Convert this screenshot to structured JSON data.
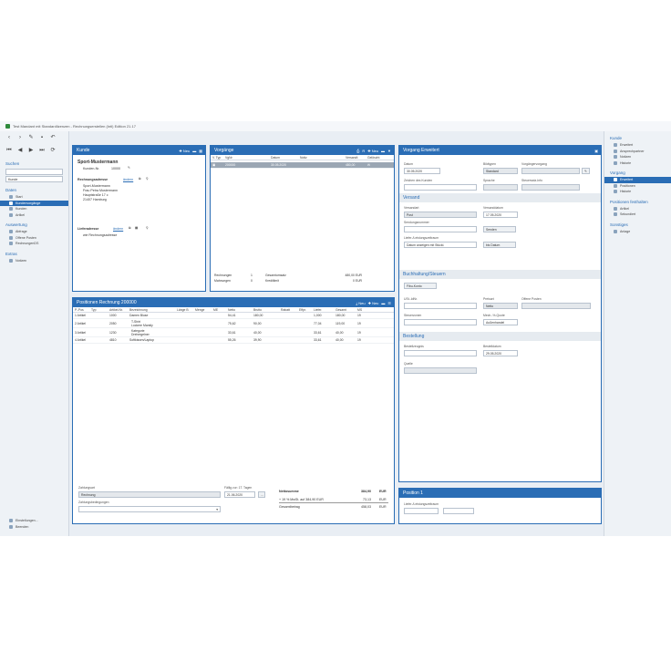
{
  "window": {
    "title": "Test Mandant mit Standardlizenzen - Rechnungserstellen (Intl) Edition 21.17"
  },
  "leftbar": {
    "search_head": "Suchen",
    "search_value": "",
    "search_scope": "Kunde",
    "daten_head": "Daten",
    "daten_items": [
      "Start",
      "Kundenvorgänge",
      "Kunden",
      "Artikel"
    ],
    "auswertung_head": "Auswertung",
    "auswertung_items": [
      "Abfrage",
      "Offene Posten",
      "RechnungenDS"
    ],
    "extras_head": "Extras",
    "extras_items": [
      "Notizen"
    ],
    "bottom_items": [
      "Einstellungen...",
      "Beenden"
    ]
  },
  "kunde": {
    "title": "Kunde",
    "new_label": "Neu",
    "name": "Sport-Mustermann",
    "kunden_nr_label": "Kunden-Nr.",
    "kunden_nr": "10000",
    "rechnungsadresse_label": "Rechnungsadresse",
    "andern": "ändern",
    "address": [
      "Sport-Mustermann",
      "Frau Petra Mustermann",
      "Hauptstraße 17 c",
      "21407 Hamburg"
    ],
    "lieferadresse_label": "Lieferadresse",
    "lieferadresse_value": "wie Rechnungsadresse"
  },
  "vorgaenge": {
    "title": "Vorgänge",
    "new_label": "Neu",
    "columns": [
      "V. Typ",
      "VgNr",
      "Datum",
      "Notiz",
      "Versandt",
      "Gelöscht"
    ],
    "row": {
      "nr": "200000",
      "datum": "30.05.2020",
      "betrag": "480,00"
    },
    "stats": [
      {
        "label": "Rechnungen",
        "count": "1",
        "key": "Gesamtumsatz",
        "value": "480,00 EUR"
      },
      {
        "label": "Mahnungen",
        "count": "0",
        "key": "Kreditlimit",
        "value": "0 EUR"
      }
    ]
  },
  "positionen": {
    "title": "Positionen Rechnung 200000",
    "new_label": "Neu",
    "columns": [
      "P.-Pos",
      "Typ",
      "Artikel-Nr.",
      "Bezeichnung",
      "Länge B",
      "Menge",
      "ME",
      "Netto",
      "Brutto",
      "Rabatt",
      "Effpr.",
      "Liefer.",
      "Gesamt",
      "MS"
    ],
    "rows": [
      {
        "pos": "1 Artikel",
        "nr": "1000",
        "bez": "Damen Bluse",
        "netto": "54,41",
        "brutto": "180,00",
        "liefer": "1,000",
        "gesamt": "180,00",
        "ms": "19"
      },
      {
        "pos": "2 Artikel",
        "nr": "2050",
        "bez": "T-Shirt",
        "bez2": "Lockere Mamily",
        "netto": "75,62",
        "brutto": "90,00",
        "liefer": "77,04",
        "gesamt": "119,00",
        "ms": "19"
      },
      {
        "pos": "3 Artikel",
        "nr": "1230",
        "bez": "Kategorie",
        "bez2": "Drehregelner",
        "netto": "33,61",
        "brutto": "40,00",
        "liefer": "33,61",
        "gesamt": "40,00",
        "ms": "19"
      },
      {
        "pos": "4 Artikel",
        "nr": "4810",
        "bez": "Softkissen/Laptop",
        "netto": "55,26",
        "brutto": "39,90",
        "liefer": "33,61",
        "gesamt": "40,00",
        "ms": "19"
      }
    ],
    "zahlungsart_label": "Zahlungsart",
    "zahlungsart_value": "Rechnung",
    "zahlungsbedingungen_label": "Zahlungsbedingungen",
    "faellig_label": "Fällig zur: 1T. Tagen",
    "faellig_value": "21.06.2020",
    "netto_label": "Nettosumme",
    "netto_value": "384,90",
    "mwst_label": "+ 19 % MwSt. auf 384,90 EUR",
    "mwst_value": "73,13",
    "gesamt_label": "Gesamtbetrag",
    "gesamt_value": "458,03",
    "currency": "EUR"
  },
  "vorgang": {
    "title": "Vorgang Erweitert",
    "datum_label": "Datum",
    "datum_value": "30.05.2020",
    "bildtypen_label": "Bildtypen",
    "bildtypen_value": "Standard",
    "vorgaengervorgang_label": "Vorgängervorgang",
    "zeichen_label": "Zeichen des Kunden",
    "sprache_label": "Sprache",
    "steuersatz_label": "Steuersatz-Info",
    "versand_head": "Versand",
    "versandart_label": "Versandart",
    "versandart_value": "Post",
    "versanddatum_label": "Versanddatum",
    "versanddatum_value": "17.05.2020",
    "sendungsnummer_label": "Sendungsnummer",
    "senden_label": "Senden",
    "liefer_label": "Liefer-/Leistungszeitraum",
    "liefer_value": "Datum anzeigen mit Stückl.",
    "bis_datum_label": "bis Datum",
    "buchhaltung_head": "Buchhaltung/Steuern",
    "fibu_label": "Fibu-Konto",
    "ust_label": "USt.-IdNr.",
    "preisart_label": "Preisart",
    "preisart_value": "Netto",
    "offene_label": "Offene Posten",
    "steuerzone_label": "Steuerzonen",
    "mech_label": "Mech.-%-Quote",
    "mech_value": "Außenhandel",
    "bestellung_head": "Bestellung",
    "bestellzeugnis_label": "Bestellzeugnis",
    "bestelldatum_label": "Bestelldatum",
    "bestelldatum_value": "29.05.2020",
    "quelle_label": "Quelle"
  },
  "position1": {
    "title": "Position 1",
    "label": "Liefer-/Leistungszeitraum"
  },
  "rightbar": {
    "kunde_head": "Kunde",
    "kunde_items": [
      "Erweitert",
      "Ansprechpartner",
      "Notizen",
      "Historie"
    ],
    "vorgang_head": "Vorgang",
    "vorgang_items": [
      "Erweitert",
      "Positionen",
      "Historie"
    ],
    "positionen_head": "Positionen festhalten",
    "positionen_items": [
      "Artikel",
      "Sekundiert"
    ],
    "sonstiges_head": "Sonstiges",
    "sonstiges_items": [
      "Anlage"
    ]
  }
}
